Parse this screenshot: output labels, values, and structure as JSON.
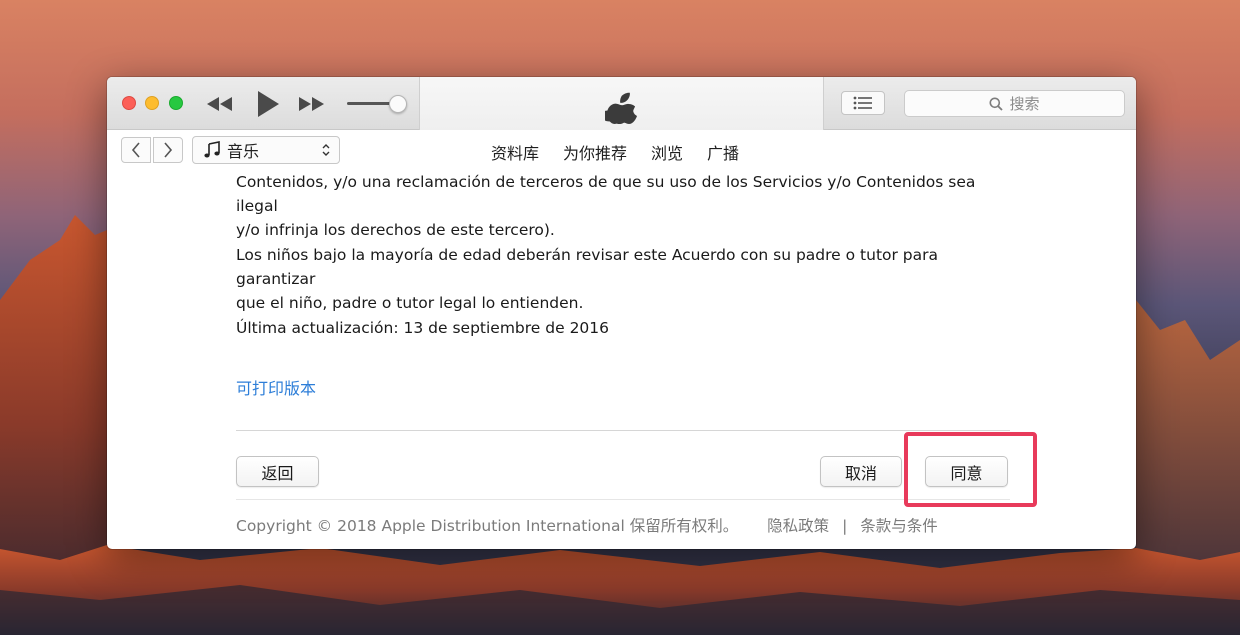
{
  "toolbar": {
    "search_placeholder": "搜索"
  },
  "navbar": {
    "media_select": "音乐",
    "tabs": [
      "资料库",
      "为你推荐",
      "浏览",
      "广播"
    ]
  },
  "content": {
    "para1_line1": "Contenidos, y/o una reclamación de terceros de que su uso de los Servicios y/o Contenidos sea ilegal",
    "para1_line2": "y/o infrinja los derechos de este tercero).",
    "para2_line1": "Los niños bajo la mayoría de edad deberán revisar este Acuerdo con su padre o tutor para garantizar",
    "para2_line2": "que el niño, padre o tutor legal lo entienden.",
    "last_updated": "Última actualización: 13 de septiembre de 2016",
    "printable_link": "可打印版本"
  },
  "buttons": {
    "back": "返回",
    "cancel": "取消",
    "agree": "同意"
  },
  "footer": {
    "copyright": "Copyright © 2018 Apple Distribution International 保留所有权利。",
    "privacy": "隐私政策",
    "separator": "|",
    "terms": "条款与条件"
  },
  "colors": {
    "link": "#2d7ed8",
    "highlight": "#e83a5b"
  }
}
